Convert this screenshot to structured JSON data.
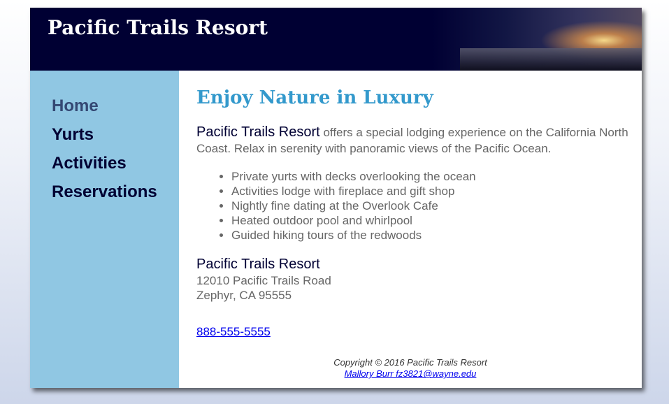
{
  "header": {
    "title": "Pacific Trails Resort"
  },
  "nav": {
    "items": [
      {
        "label": "Home"
      },
      {
        "label": "Yurts"
      },
      {
        "label": "Activities"
      },
      {
        "label": "Reservations"
      }
    ]
  },
  "main": {
    "heading": "Enjoy Nature in Luxury",
    "intro_brand": "Pacific Trails Resort",
    "intro_text": " offers a special lodging experience on the California North Coast. Relax in serenity with panoramic views of the Pacific Ocean.",
    "features": [
      "Private yurts with decks overlooking the ocean",
      "Activities lodge with fireplace and gift shop",
      "Nightly fine dating at the Overlook Cafe",
      "Heated outdoor pool and whirlpool",
      "Guided hiking tours of the redwoods"
    ],
    "contact": {
      "name": "Pacific Trails Resort",
      "street": "12010 Pacific Trails Road",
      "city": "Zephyr, CA 95555",
      "phone": "888-555-5555"
    }
  },
  "footer": {
    "copyright": "Copyright © 2016 Pacific Trails Resort",
    "author_link": "Mallory Burr fz3821@wayne.edu"
  },
  "colors": {
    "header_bg": "#000033",
    "nav_bg": "#90c7e3",
    "heading": "#3399cc",
    "body_text": "#666666",
    "nav_text": "#000033"
  }
}
